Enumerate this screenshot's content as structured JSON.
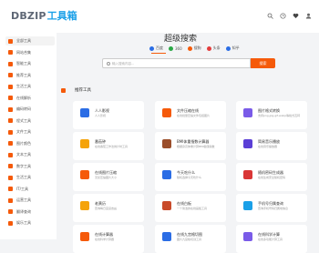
{
  "logo": {
    "latin": "DBZIP",
    "cn": "工具箱"
  },
  "sidebar": {
    "items": [
      {
        "label": "全部工具",
        "color": "#f55a0a"
      },
      {
        "label": "网站合集",
        "color": "#f55a0a"
      },
      {
        "label": "智能工具",
        "color": "#f55a0a"
      },
      {
        "label": "推荐工具",
        "color": "#f55a0a"
      },
      {
        "label": "生活工具",
        "color": "#f55a0a"
      },
      {
        "label": "在线解析",
        "color": "#f55a0a"
      },
      {
        "label": "编码转码",
        "color": "#f55a0a"
      },
      {
        "label": "程式工具",
        "color": "#f55a0a"
      },
      {
        "label": "文件工具",
        "color": "#f55a0a"
      },
      {
        "label": "图片颜色",
        "color": "#f55a0a"
      },
      {
        "label": "文本工具",
        "color": "#f55a0a"
      },
      {
        "label": "数字工具",
        "color": "#f55a0a"
      },
      {
        "label": "生活工具",
        "color": "#f55a0a"
      },
      {
        "label": "IT/工具",
        "color": "#f55a0a"
      },
      {
        "label": "运营工具",
        "color": "#f55a0a"
      },
      {
        "label": "翻译查询",
        "color": "#f55a0a"
      },
      {
        "label": "娱乐工具",
        "color": "#f55a0a"
      }
    ]
  },
  "search": {
    "title": "超级搜索",
    "engines": [
      {
        "label": "百度",
        "color": "#2b6de5"
      },
      {
        "label": "360",
        "color": "#2aa846"
      },
      {
        "label": "搜狗",
        "color": "#f55a0a"
      },
      {
        "label": "头条",
        "color": "#e33c3c"
      },
      {
        "label": "知乎",
        "color": "#2b6de5"
      }
    ],
    "placeholder": "输入搜索内容...",
    "button": "搜索"
  },
  "recommend": {
    "label": "推荐工具"
  },
  "cards": [
    {
      "title": "人人影视",
      "desc": "人人影视",
      "color": "#2b6de5"
    },
    {
      "title": "文件压缩在线",
      "desc": "在线批量压缩文件包括图片",
      "color": "#f55a0a"
    },
    {
      "title": "图片格式转换",
      "desc": "支持png,jpg,gif,webp等格式互转",
      "color": "#7a5be8"
    },
    {
      "title": "番茄钟",
      "desc": "在线番茄工作法倒计时工具",
      "color": "#f5a30a"
    },
    {
      "title": "BMI体重指数计算器",
      "desc": "根据身高体重计算BMI健康指数",
      "color": "#9b4e2a"
    },
    {
      "title": "简易音乐播放",
      "desc": "在线音乐播放器",
      "color": "#5b3fd6"
    },
    {
      "title": "在线图片压缩",
      "desc": "无损压缩图片大小",
      "color": "#f55a0a"
    },
    {
      "title": "今天吃什么",
      "desc": "随机选择今天吃什么",
      "color": "#2b6de5"
    },
    {
      "title": "随机密码生成器",
      "desc": "在线生成安全随机密码",
      "color": "#d93636"
    },
    {
      "title": "老黄历",
      "desc": "查询每日宜忌吉凶",
      "color": "#f5a30a"
    },
    {
      "title": "在线白板",
      "desc": "一个简洁的在线画板工具",
      "color": "#c94b2a"
    },
    {
      "title": "手机号归属查询",
      "desc": "查询手机号码归属地信息",
      "color": "#1aa0e8"
    },
    {
      "title": "在线计算器",
      "desc": "在线科学计算器",
      "color": "#f55a0a"
    },
    {
      "title": "在线九宫格切图",
      "desc": "图片九宫格切割工具",
      "color": "#2b6de5"
    },
    {
      "title": "在线科学计算",
      "desc": "在线多功能计算工具",
      "color": "#7a5be8"
    }
  ]
}
